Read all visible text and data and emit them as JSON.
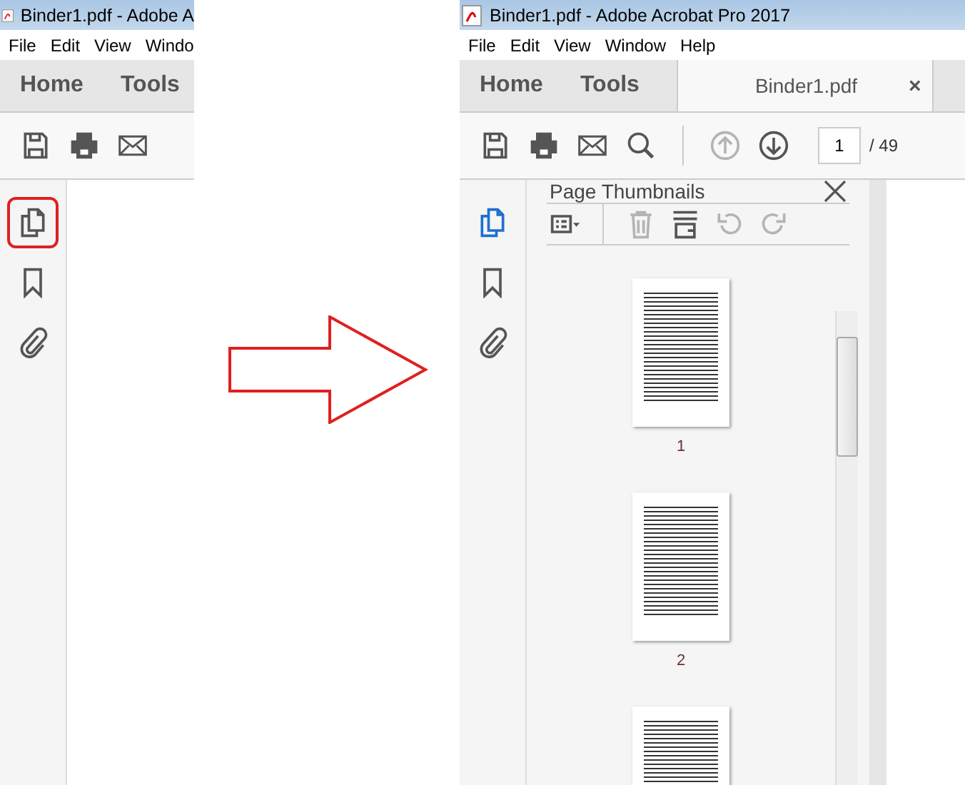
{
  "before": {
    "title": "Binder1.pdf - Adobe A",
    "menu": [
      "File",
      "Edit",
      "View",
      "Windo"
    ],
    "tabs": [
      {
        "label": "Home",
        "selected": false
      },
      {
        "label": "Tools",
        "selected": false
      }
    ],
    "toolbar": [
      {
        "kind": "save",
        "disabled": false
      },
      {
        "kind": "print",
        "disabled": false
      },
      {
        "kind": "mail",
        "disabled": false
      }
    ],
    "rail": [
      {
        "kind": "pages",
        "selected": false,
        "highlighted": true
      },
      {
        "kind": "bookmark",
        "selected": false,
        "highlighted": false
      },
      {
        "kind": "attach",
        "selected": false,
        "highlighted": false
      }
    ]
  },
  "after": {
    "title": "Binder1.pdf - Adobe Acrobat Pro 2017",
    "menu": [
      "File",
      "Edit",
      "View",
      "Window",
      "Help"
    ],
    "tabs": [
      {
        "label": "Home",
        "selected": false
      },
      {
        "label": "Tools",
        "selected": false
      },
      {
        "label": "Binder1.pdf",
        "selected": true,
        "close": "×"
      }
    ],
    "toolbar": [
      {
        "kind": "save",
        "disabled": false
      },
      {
        "kind": "print",
        "disabled": false
      },
      {
        "kind": "mail",
        "disabled": false
      },
      {
        "kind": "search",
        "disabled": false
      },
      {
        "kind": "sep"
      },
      {
        "kind": "up",
        "disabled": true
      },
      {
        "kind": "down",
        "disabled": false
      }
    ],
    "page_field": {
      "value": "1",
      "total": "/ 49"
    },
    "rail": [
      {
        "kind": "pages",
        "selected": true,
        "highlighted": false
      },
      {
        "kind": "bookmark",
        "selected": false,
        "highlighted": false
      },
      {
        "kind": "attach",
        "selected": false,
        "highlighted": false
      }
    ],
    "panel": {
      "title": "Page Thumbnails",
      "tools": [
        {
          "kind": "options",
          "disabled": false
        },
        {
          "kind": "sep"
        },
        {
          "kind": "delete",
          "disabled": true
        },
        {
          "kind": "extract",
          "disabled": false
        },
        {
          "kind": "undo",
          "disabled": true
        },
        {
          "kind": "redo",
          "disabled": true
        }
      ],
      "thumbnails": [
        {
          "label": "1",
          "selected": false
        },
        {
          "label": "2",
          "selected": false
        },
        {
          "selected": false
        }
      ]
    }
  }
}
